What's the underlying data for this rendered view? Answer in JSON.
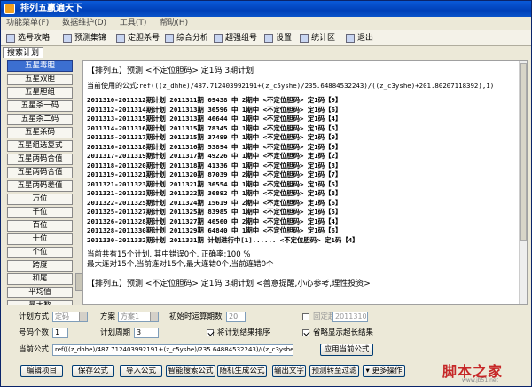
{
  "window": {
    "title": "排列五赢遍天下"
  },
  "menu": [
    "功能菜单(F)",
    "数据维护(D)",
    "工具(T)",
    "帮助(H)"
  ],
  "toolbar": [
    "选号攻略",
    "预测集锦",
    "定胆杀号",
    "综合分析",
    "超强组号",
    "设置",
    "统计区",
    "退出"
  ],
  "tab": "搜索计划",
  "sidebar": [
    "五星毒胆",
    "五星双胆",
    "五星胆组",
    "五星杀一码",
    "五星杀二码",
    "五星杀码",
    "五星组选复式",
    "五星两码合值",
    "五星两码合值",
    "五星两码差值",
    "万位",
    "千位",
    "百位",
    "十位",
    "个位",
    "跨度",
    "和尾",
    "平均值",
    "最大数"
  ],
  "sidebar_active": 0,
  "content": {
    "header": "【排列五】预测 <不定位胆码> 定1码 3期计划",
    "formula_label": "当前使用的公式:",
    "formula": "ref(((z_dhhe)/487.712403992191+(z_c5yshe)/235.64884532243)/((z_c3yshe)+201.80207118392),1)",
    "rows": [
      "2011310-2011312期计划 2011311期 09438 中 2期中 <不定位胆码> 定1码【9】",
      "2011312-2011314期计划 2011313期 36596 中 1期中 <不定位胆码> 定1码【6】",
      "2011313-2011315期计划 2011313期 46644 中 1期中 <不定位胆码> 定1码【4】",
      "2011314-2011316期计划 2011315期 78345 中 1期中 <不定位胆码> 定1码【5】",
      "2011315-2011317期计划 2011315期 37499 中 1期中 <不定位胆码> 定1码【9】",
      "2011316-2011318期计划 2011316期 53894 中 1期中 <不定位胆码> 定1码【9】",
      "2011317-2011319期计划 2011317期 49226 中 1期中 <不定位胆码> 定1码【2】",
      "2011318-2011320期计划 2011318期 41336 中 1期中 <不定位胆码> 定1码【3】",
      "2011319-2011321期计划 2011320期 87039 中 2期中 <不定位胆码> 定1码【7】",
      "2011321-2011323期计划 2011321期 36554 中 1期中 <不定位胆码> 定1码【5】",
      "2011321-2011323期计划 2011322期 36892 中 1期中 <不定位胆码> 定1码【8】",
      "2011322-2011325期计划 2011324期 15619 中 2期中 <不定位胆码> 定1码【6】",
      "2011325-2011327期计划 2011325期 83985 中 1期中 <不定位胆码> 定1码【5】",
      "2011326-2011328期计划 2011327期 46560 中 2期中 <不定位胆码> 定1码【4】",
      "2011328-2011330期计划 2011329期 64840 中 1期中 <不定位胆码> 定1码【6】",
      "2011330-2011332期计划 2011331期 计划进行中[1]...... <不定位胆码> 定1码【4】"
    ],
    "summary": [
      "当前共有15个计划, 其中错误0个, 正确率:100 %",
      "最大连对15个,当前连对15个,最大连错0个,当前连错0个"
    ],
    "last_line": "【排列五】预测 <不定位胆码> 定1码 3期计划 <善意提醒,小心参考,理性投资>"
  },
  "controls": {
    "plan_mode_label": "计划方式",
    "plan_mode_value": "定码",
    "scheme_label": "方案",
    "scheme_value": "方案1",
    "init_label": "初始时运算期数",
    "init_value": "20",
    "fixed_label": "固定起始期",
    "fixed_value": "2011310",
    "count_label": "号码个数",
    "count_value": "1",
    "period_label": "计划周期",
    "period_value": "3",
    "sort_label": "将计划结果排序",
    "omit_label": "省略显示超长结果",
    "formula_label": "当前公式",
    "formula_value": "ref(((z_dhhe)/487.712403992191+(z_c5yshe)/235.64884532243)/((z_c3yshe)+201.80207118392),1)",
    "apply_label": "应用当前公式"
  },
  "buttons": [
    "编辑项目",
    "保存公式",
    "导入公式",
    "智能搜索公式",
    "随机生成公式",
    "输出文字",
    "预测转至过滤",
    "更多操作"
  ],
  "watermark": {
    "text": "脚本之家",
    "url": "www.jb51.net"
  }
}
